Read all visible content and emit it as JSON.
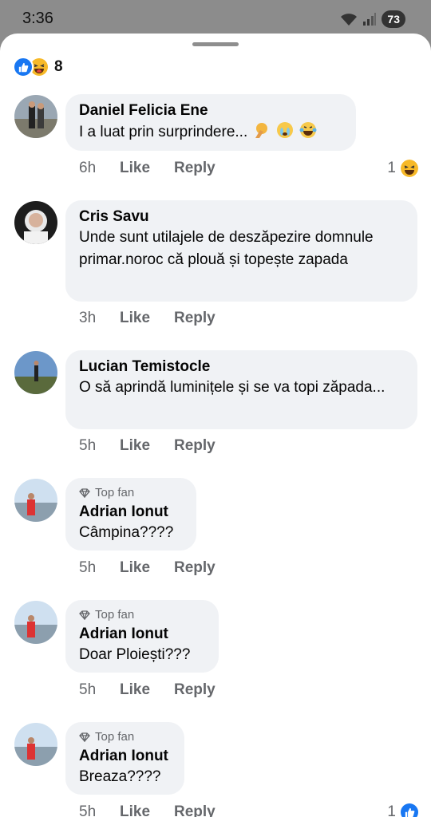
{
  "status_bar": {
    "time": "3:36",
    "battery": "73"
  },
  "reactions": {
    "count": "8"
  },
  "comments": [
    {
      "author": "Daniel Felicia Ene",
      "text": "I a luat prin surprindere...",
      "time": "6h",
      "like": "Like",
      "reply": "Reply",
      "reaction_count": "1"
    },
    {
      "author": "Cris Savu",
      "text": "Unde sunt utilajele de deszăpezire domnule primar.noroc că plouă și topește zapada",
      "time": "3h",
      "like": "Like",
      "reply": "Reply"
    },
    {
      "author": "Lucian Temistocle",
      "text": "O să aprindă luminițele și se va topi zăpada...",
      "time": "5h",
      "like": "Like",
      "reply": "Reply"
    },
    {
      "badge": "Top fan",
      "author": "Adrian Ionut",
      "text": "Câmpina????",
      "time": "5h",
      "like": "Like",
      "reply": "Reply"
    },
    {
      "badge": "Top fan",
      "author": "Adrian Ionut",
      "text": "Doar Ploiești???",
      "time": "5h",
      "like": "Like",
      "reply": "Reply"
    },
    {
      "badge": "Top fan",
      "author": "Adrian Ionut",
      "text": "Breaza????",
      "time": "5h",
      "like": "Like",
      "reply": "Reply",
      "reaction_count": "1"
    }
  ]
}
